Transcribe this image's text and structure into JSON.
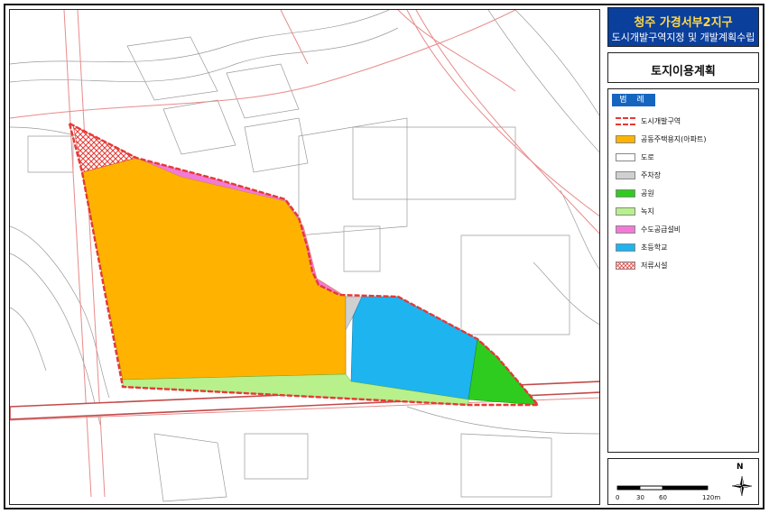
{
  "title": {
    "project": "청주 가경서부2지구",
    "subtitle": "도시개발구역지정 및 개발계획수립"
  },
  "plan_title": "토지이용계획",
  "legend": {
    "header": "범 례",
    "items": [
      {
        "label": "도시개발구역",
        "color": "#e53935",
        "pattern": "boundary"
      },
      {
        "label": "공동주택용지(아파트)",
        "color": "#ffb300",
        "pattern": "solid"
      },
      {
        "label": "도로",
        "color": "#ffffff",
        "pattern": "solid"
      },
      {
        "label": "주차장",
        "color": "#d0d0d0",
        "pattern": "solid"
      },
      {
        "label": "공원",
        "color": "#2ecc1f",
        "pattern": "solid"
      },
      {
        "label": "녹지",
        "color": "#b8f08c",
        "pattern": "solid"
      },
      {
        "label": "수도공급설비",
        "color": "#f27ad6",
        "pattern": "solid"
      },
      {
        "label": "초등학교",
        "color": "#1eb4f0",
        "pattern": "solid"
      },
      {
        "label": "저류시설",
        "color": "#e57373",
        "pattern": "hatch"
      }
    ]
  },
  "scale_bar": {
    "ticks": [
      "0",
      "30",
      "60",
      "120m"
    ],
    "north_label": "N"
  },
  "colors": {
    "title_bg": "#0a3f9c",
    "title_text": "#ffd84a",
    "boundary": "#e53935",
    "road_lines": "#e88b8b",
    "base_lines": "#9a9a9a"
  }
}
